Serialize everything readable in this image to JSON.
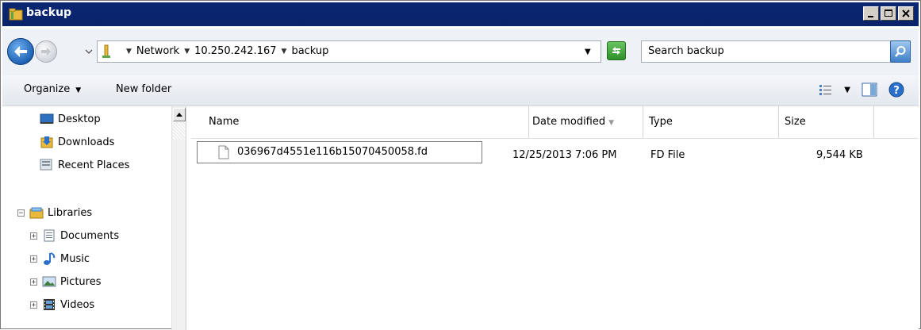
{
  "window": {
    "title": "backup"
  },
  "address": {
    "crumbs": [
      "Network",
      "10.250.242.167",
      "backup"
    ]
  },
  "search": {
    "placeholder": "Search backup"
  },
  "toolbar": {
    "organize_label": "Organize",
    "new_folder_label": "New folder"
  },
  "nav": {
    "favorites": [
      {
        "label": "Desktop",
        "icon": "desktop-icon"
      },
      {
        "label": "Downloads",
        "icon": "downloads-icon"
      },
      {
        "label": "Recent Places",
        "icon": "recent-places-icon"
      }
    ],
    "libraries": {
      "label": "Libraries",
      "children": [
        {
          "label": "Documents",
          "icon": "documents-icon"
        },
        {
          "label": "Music",
          "icon": "music-icon"
        },
        {
          "label": "Pictures",
          "icon": "pictures-icon"
        },
        {
          "label": "Videos",
          "icon": "videos-icon"
        }
      ]
    }
  },
  "columns": {
    "name": "Name",
    "date": "Date modified",
    "type": "Type",
    "size": "Size"
  },
  "files": [
    {
      "name": "036967d4551e116b15070450058.fd",
      "date": "12/25/2013 7:06 PM",
      "type": "FD File",
      "size": "9,544 KB"
    }
  ],
  "colors": {
    "titlebar": "#0a246a",
    "toolbar": "#e3e8ee",
    "accent": "#1d62b4"
  }
}
